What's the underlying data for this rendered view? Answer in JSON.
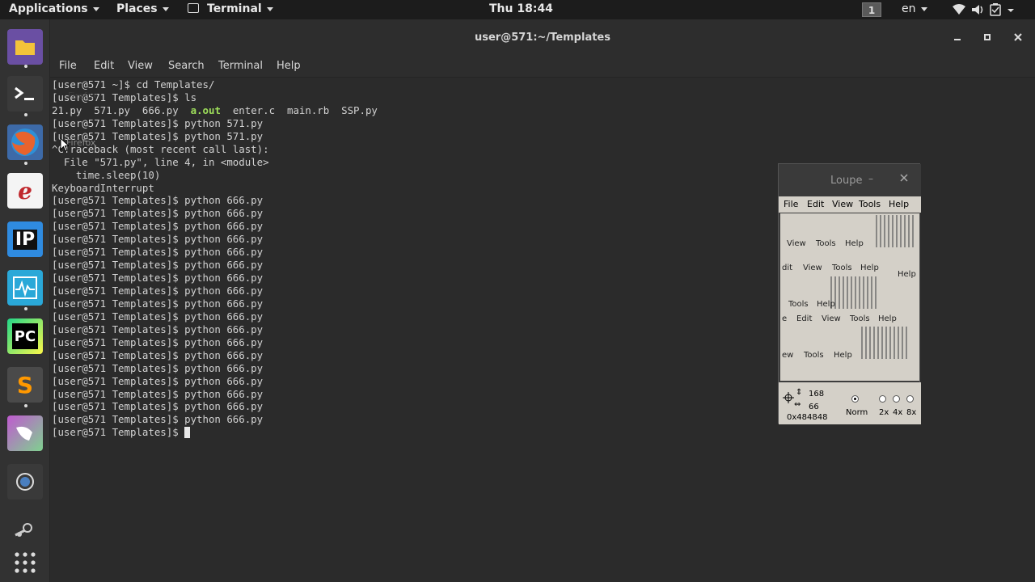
{
  "topbar": {
    "applications": "Applications",
    "places": "Places",
    "app": "Terminal",
    "clock": "Thu 18:44",
    "workspace": "1",
    "lang": "en"
  },
  "window": {
    "title": "user@571:~/Templates",
    "menu": [
      "File",
      "Edit",
      "View",
      "Search",
      "Terminal",
      "Help"
    ]
  },
  "console": {
    "lines": [
      "[user@571 ~]$ cd Templates/",
      "[user@571 Templates]$ ls",
      "__LS__",
      "[user@571 Templates]$ python 571.py",
      "[user@571 Templates]$ python 571.py",
      "^CTraceback (most recent call last):",
      "  File \"571.py\", line 4, in <module>",
      "    time.sleep(10)",
      "KeyboardInterrupt",
      "[user@571 Templates]$ python 666.py",
      "[user@571 Templates]$ python 666.py",
      "[user@571 Templates]$ python 666.py",
      "[user@571 Templates]$ python 666.py",
      "[user@571 Templates]$ python 666.py",
      "[user@571 Templates]$ python 666.py",
      "[user@571 Templates]$ python 666.py",
      "[user@571 Templates]$ python 666.py",
      "[user@571 Templates]$ python 666.py",
      "[user@571 Templates]$ python 666.py",
      "[user@571 Templates]$ python 666.py",
      "[user@571 Templates]$ python 666.py",
      "[user@571 Templates]$ python 666.py",
      "[user@571 Templates]$ python 666.py",
      "[user@571 Templates]$ python 666.py",
      "[user@571 Templates]$ python 666.py",
      "[user@571 Templates]$ python 666.py",
      "[user@571 Templates]$ python 666.py"
    ],
    "ls_files": [
      "21.py",
      "571.py",
      "666.py",
      "a.out",
      "enter.c",
      "main.rb",
      "SSP.py"
    ],
    "prompt": "[user@571 Templates]$ "
  },
  "tooltip": "Firefox",
  "loupe": {
    "title": "Loupe",
    "menu": [
      "File",
      "Edit",
      "View",
      "Tools",
      "Help"
    ],
    "x": "168",
    "y": "66",
    "color": "0x484848",
    "norm": "Norm",
    "zoom_options": [
      "2x",
      "4x",
      "8x"
    ],
    "fragments": [
      "View",
      "Tools",
      "Help",
      "dit",
      "View",
      "Tools",
      "Help",
      "Help",
      "Tools",
      "Help",
      "e",
      "Edit",
      "View",
      "Tools",
      "Help",
      "ew",
      "Tools",
      "Help"
    ]
  },
  "dock": {
    "apps": [
      "files",
      "terminal",
      "firefox",
      "text-editor",
      "pycharm-edu",
      "system-monitor",
      "pycharm",
      "sublime-text",
      "image-viewer",
      "screenshot",
      "steam",
      "show-apps"
    ]
  }
}
